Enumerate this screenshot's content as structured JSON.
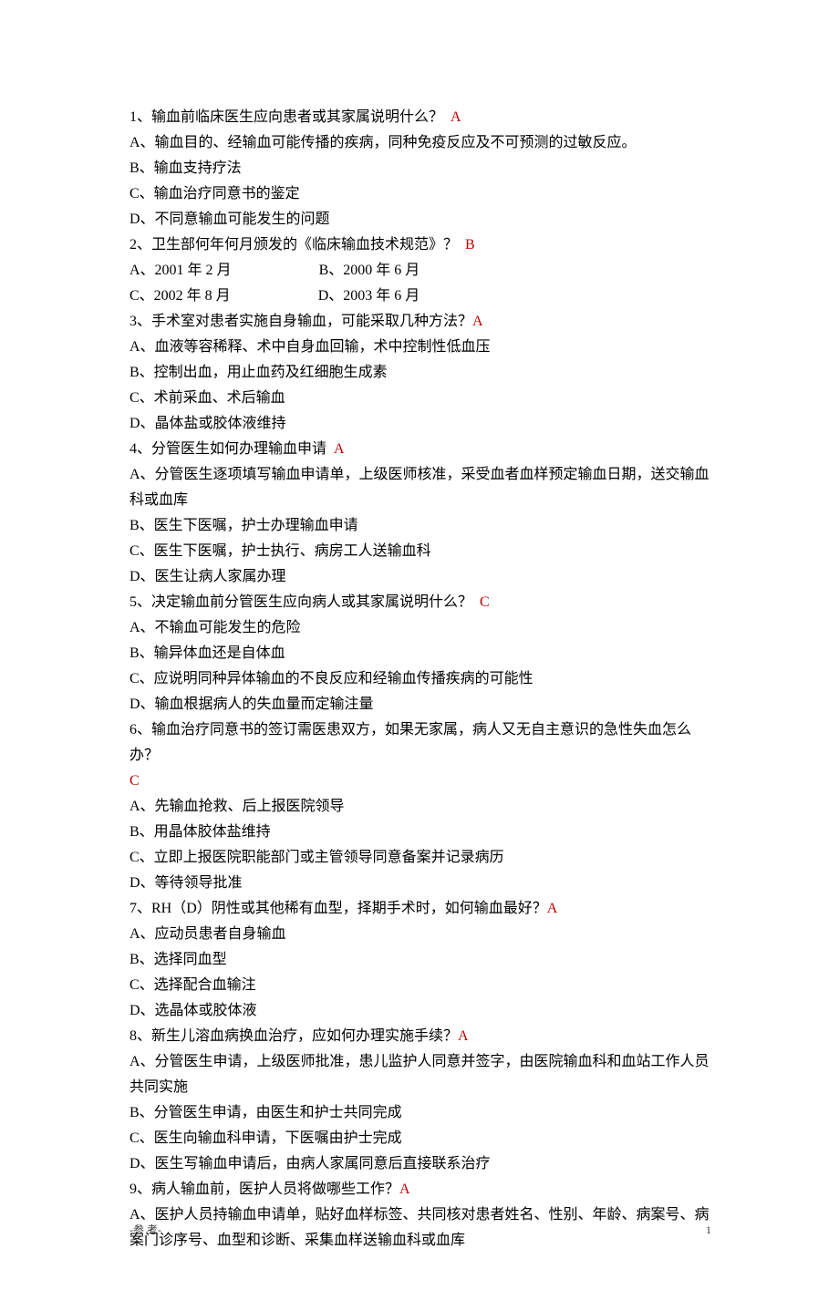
{
  "questions": [
    {
      "q": "1、输血前临床医生应向患者或其家属说明什么？",
      "ans": "A",
      "opts": [
        "A、输血目的、经输血可能传播的疾病，同种免疫反应及不可预测的过敏反应。",
        "B、输血支持疗法",
        "C、输血治疗同意书的鉴定",
        "D、不同意输血可能发生的问题"
      ]
    },
    {
      "q": "2、卫生部何年何月颁发的《临床输血技术规范》？",
      "ans": "B",
      "inline": [
        [
          "A、2001 年 2 月",
          "B、2000 年 6 月"
        ],
        [
          "C、2002 年 8 月",
          "D、2003 年 6 月"
        ]
      ]
    },
    {
      "q": "3、手术室对患者实施自身输血，可能采取几种方法？",
      "ans": "A",
      "ans_inline": true,
      "opts": [
        "A、血液等容稀释、术中自身血回输，术中控制性低血压",
        "B、控制出血，用止血药及红细胞生成素",
        "C、术前采血、术后输血",
        "D、晶体盐或胶体液维持"
      ]
    },
    {
      "q": "4、分管医生如何办理输血申请",
      "ans": "A",
      "opts": [
        "A、分管医生逐项填写输血申请单，上级医师核准，采受血者血样预定输血日期，送交输血科或血库",
        "B、医生下医嘱，护士办理输血申请",
        "C、医生下医嘱，护士执行、病房工人送输血科",
        "D、医生让病人家属办理"
      ]
    },
    {
      "q": "5、决定输血前分管医生应向病人或其家属说明什么？",
      "ans": "C",
      "opts": [
        "A、不输血可能发生的危险",
        "B、输异体血还是自体血",
        "C、应说明同种异体输血的不良反应和经输血传播疾病的可能性",
        "D、输血根据病人的失血量而定输注量"
      ]
    },
    {
      "q": "6、输血治疗同意书的签订需医患双方，如果无家属，病人又无自主意识的急性失血怎么办？",
      "ans": "C",
      "ans_newline": true,
      "opts": [
        "A、先输血抢救、后上报医院领导",
        "B、用晶体胶体盐维持",
        "C、立即上报医院职能部门或主管领导同意备案并记录病历",
        "D、等待领导批准"
      ]
    },
    {
      "q": "7、RH（D）阴性或其他稀有血型，择期手术时，如何输血最好？",
      "ans": "A",
      "ans_inline": true,
      "opts": [
        "A、应动员患者自身输血",
        "B、选择同血型",
        "C、选择配合血输注",
        "D、选晶体或胶体液"
      ]
    },
    {
      "q": "8、新生儿溶血病换血治疗，应如何办理实施手续？",
      "ans": "A",
      "ans_inline": true,
      "opts": [
        "A、分管医生申请，上级医师批准，患儿监护人同意并签字，由医院输血科和血站工作人员共同实施",
        "B、分管医生申请，由医生和护士共同完成",
        "C、医生向输血科申请，下医嘱由护士完成",
        "D、医生写输血申请后，由病人家属同意后直接联系治疗"
      ]
    },
    {
      "q": "9、病人输血前，医护人员将做哪些工作？",
      "ans": "A",
      "ans_inline": true,
      "opts": [
        "A、医护人员持输血申请单，贴好血样标签、共同核对患者姓名、性别、年龄、病案号、病案门诊序号、血型和诊断、采集血样送输血科或血库"
      ]
    }
  ],
  "footer": {
    "left": "-参 考-",
    "right": "1"
  }
}
